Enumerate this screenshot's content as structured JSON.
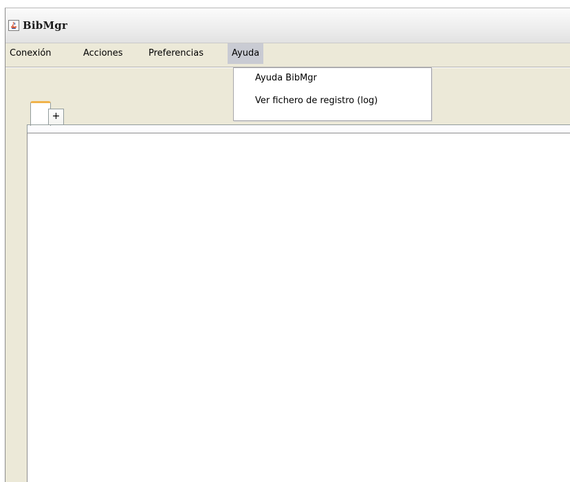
{
  "window": {
    "title": "BibMgr",
    "icon": "java-cup-icon"
  },
  "menubar": {
    "items": [
      {
        "label": "Conexión"
      },
      {
        "label": "Acciones"
      },
      {
        "label": "Preferencias"
      },
      {
        "label": "Ayuda",
        "active": true
      }
    ]
  },
  "dropdown": {
    "items": [
      {
        "label": "Ayuda BibMgr"
      },
      {
        "label": "Ver fichero de registro (log)"
      }
    ]
  },
  "tabs": {
    "add_label": "+"
  },
  "colors": {
    "accent_tab": "#f0b34b",
    "menu_highlight": "#c9cbd3",
    "window_bg": "#ece9d8"
  }
}
